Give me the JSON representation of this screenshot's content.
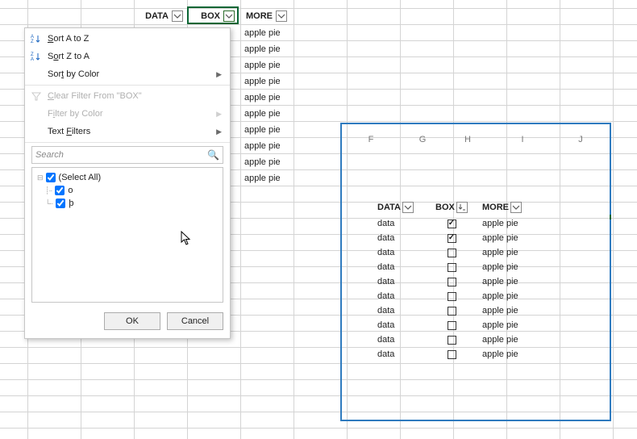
{
  "headers": {
    "data": "DATA",
    "box": "BOX",
    "more": "MORE"
  },
  "left_rows": [
    "apple pie",
    "apple pie",
    "apple pie",
    "apple pie",
    "apple pie",
    "apple pie",
    "apple pie",
    "apple pie",
    "apple pie",
    "apple pie"
  ],
  "menu": {
    "sort_az": "Sort A to Z",
    "sort_za": "Sort Z to A",
    "sort_color": "Sort by Color",
    "clear": "Clear Filter From \"BOX\"",
    "filter_color": "Filter by Color",
    "text_filters": "Text Filters",
    "search_placeholder": "Search",
    "select_all": "(Select All)",
    "opt1": "o",
    "opt2": "þ",
    "ok": "OK",
    "cancel": "Cancel"
  },
  "panel": {
    "cols": {
      "F": "F",
      "G": "G",
      "H": "H",
      "I": "I",
      "J": "J"
    },
    "th": {
      "data": "DATA",
      "box": "BOX",
      "more": "MORE"
    },
    "rows": [
      {
        "data": "data",
        "checked": true,
        "more": "apple pie"
      },
      {
        "data": "data",
        "checked": true,
        "more": "apple pie"
      },
      {
        "data": "data",
        "checked": false,
        "more": "apple pie"
      },
      {
        "data": "data",
        "checked": false,
        "more": "apple pie"
      },
      {
        "data": "data",
        "checked": false,
        "more": "apple pie"
      },
      {
        "data": "data",
        "checked": false,
        "more": "apple pie"
      },
      {
        "data": "data",
        "checked": false,
        "more": "apple pie"
      },
      {
        "data": "data",
        "checked": false,
        "more": "apple pie"
      },
      {
        "data": "data",
        "checked": false,
        "more": "apple pie"
      },
      {
        "data": "data",
        "checked": false,
        "more": "apple pie"
      }
    ]
  },
  "chart_data": {
    "type": "table",
    "title": "",
    "columns": [
      "DATA",
      "BOX",
      "MORE"
    ],
    "rows": [
      [
        "data",
        true,
        "apple pie"
      ],
      [
        "data",
        true,
        "apple pie"
      ],
      [
        "data",
        false,
        "apple pie"
      ],
      [
        "data",
        false,
        "apple pie"
      ],
      [
        "data",
        false,
        "apple pie"
      ],
      [
        "data",
        false,
        "apple pie"
      ],
      [
        "data",
        false,
        "apple pie"
      ],
      [
        "data",
        false,
        "apple pie"
      ],
      [
        "data",
        false,
        "apple pie"
      ],
      [
        "data",
        false,
        "apple pie"
      ]
    ]
  }
}
